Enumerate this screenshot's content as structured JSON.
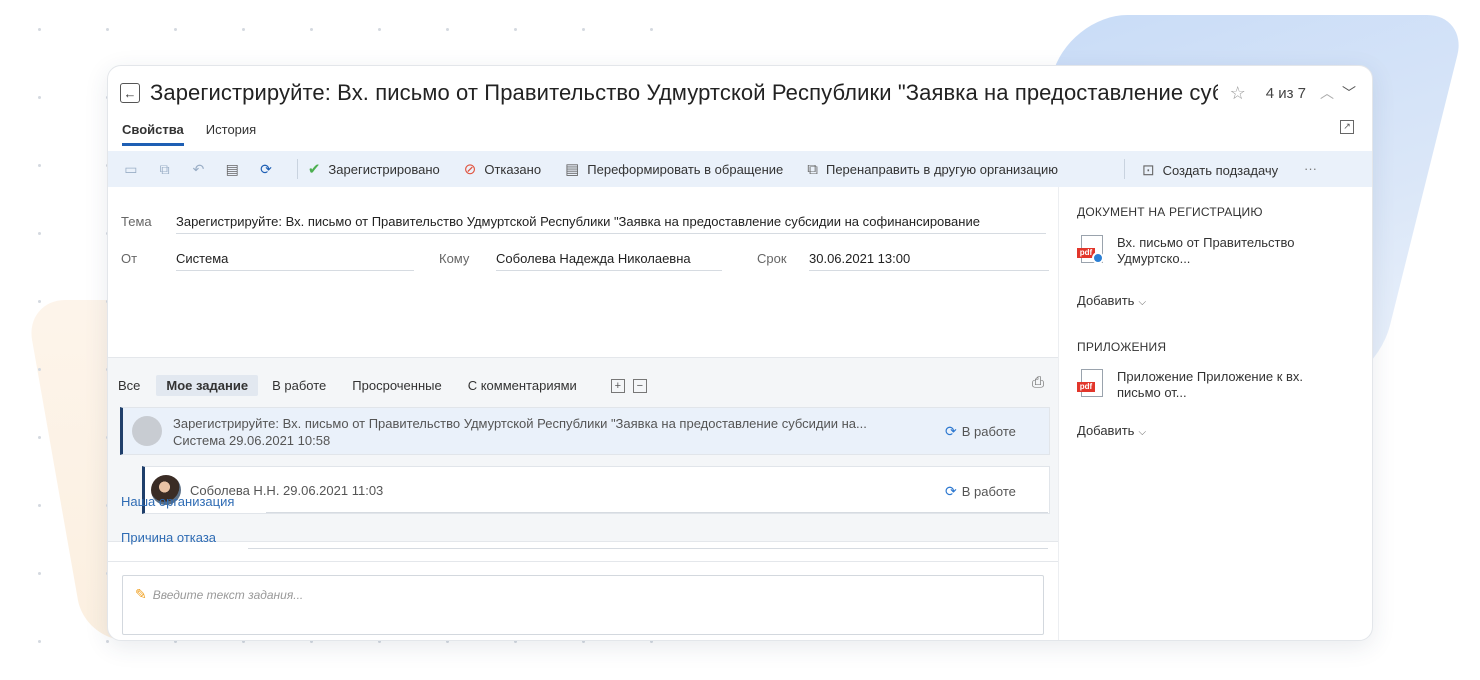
{
  "header": {
    "back_icon": "arrow-left-icon",
    "title": "Зарегистрируйте: Вх. письмо от Правительство Удмуртской Республики \"Заявка на предоставление субсидии н...",
    "counter": "4 из 7"
  },
  "tabs": [
    {
      "label": "Свойства",
      "active": true
    },
    {
      "label": "История",
      "active": false
    }
  ],
  "toolbar": {
    "registered": "Зарегистрировано",
    "rejected": "Отказано",
    "reform": "Переформировать в обращение",
    "redirect": "Перенаправить в другую организацию",
    "subtask": "Создать подзадачу",
    "more": "···"
  },
  "fields": {
    "subject_label": "Тема",
    "subject_value": "Зарегистрируйте: Вх. письмо от Правительство Удмуртской Республики \"Заявка на предоставление субсидии на софинансирование",
    "from_label": "От",
    "from_value": "Система",
    "to_label": "Кому",
    "to_value": "Соболева Надежда Николаевна",
    "deadline_label": "Срок",
    "deadline_value": "30.06.2021 13:00"
  },
  "filters": [
    {
      "label": "Все",
      "active": false
    },
    {
      "label": "Мое задание",
      "active": true
    },
    {
      "label": "В работе",
      "active": false
    },
    {
      "label": "Просроченные",
      "active": false
    },
    {
      "label": "С комментариями",
      "active": false
    }
  ],
  "tasks": [
    {
      "title": "Зарегистрируйте: Вх. письмо от Правительство Удмуртской Республики \"Заявка на предоставление субсидии на...",
      "meta": "Система  29.06.2021 10:58",
      "status": "В работе"
    },
    {
      "meta": "Соболева Н.Н.  29.06.2021 11:03",
      "status": "В работе"
    }
  ],
  "org": {
    "our_org_label": "Наша организация",
    "reject_reason_label": "Причина отказа"
  },
  "comment": {
    "placeholder": "Введите текст задания..."
  },
  "sidebar": {
    "doc_section_title": "ДОКУМЕНТ НА РЕГИСТРАЦИЮ",
    "doc_name": "Вх. письмо от Правительство Удмуртско...",
    "add_label": "Добавить",
    "attachments_title": "ПРИЛОЖЕНИЯ",
    "attachment_name": "Приложение Приложение к вх. письмо от...",
    "pdf_label": "pdf"
  },
  "colors": {
    "accent": "#1e5fb4",
    "toolbar_bg": "#eaf1fa",
    "check_green": "#4caf50",
    "reject_red": "#e0513c",
    "pdf_red": "#e2362b"
  }
}
